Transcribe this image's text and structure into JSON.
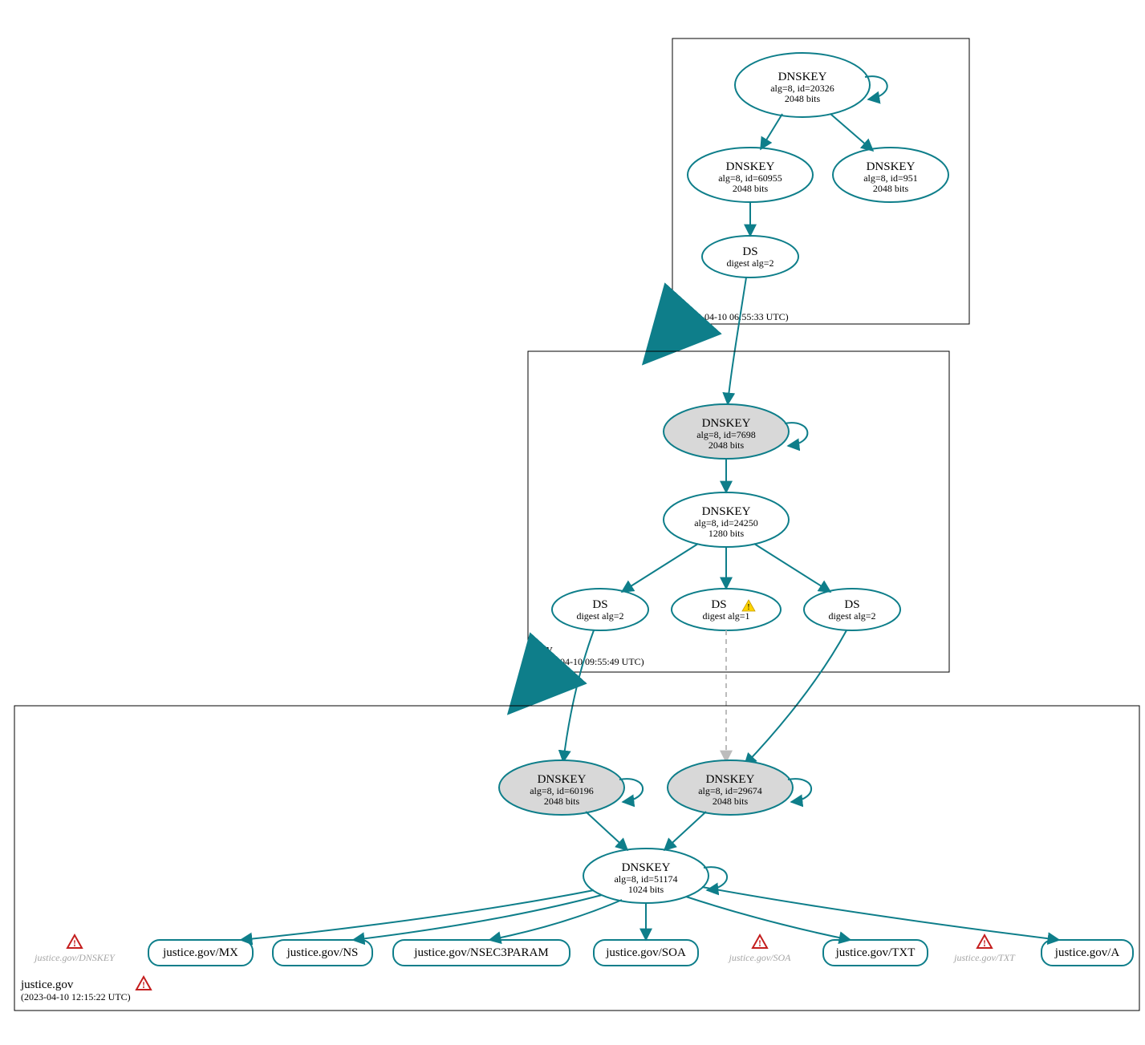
{
  "colors": {
    "stroke": "#0e7e8a",
    "fill_gray": "#d8d8d8"
  },
  "zones": {
    "root": {
      "label": ".",
      "timestamp": "(2023-04-10 06:55:33 UTC)",
      "nodes": {
        "ksk": {
          "title": "DNSKEY",
          "sub1": "alg=8, id=20326",
          "sub2": "2048 bits"
        },
        "zsk1": {
          "title": "DNSKEY",
          "sub1": "alg=8, id=60955",
          "sub2": "2048 bits"
        },
        "zsk2": {
          "title": "DNSKEY",
          "sub1": "alg=8, id=951",
          "sub2": "2048 bits"
        },
        "ds": {
          "title": "DS",
          "sub1": "digest alg=2"
        }
      }
    },
    "gov": {
      "label": "gov",
      "timestamp": "(2023-04-10 09:55:49 UTC)",
      "nodes": {
        "ksk": {
          "title": "DNSKEY",
          "sub1": "alg=8, id=7698",
          "sub2": "2048 bits"
        },
        "zsk": {
          "title": "DNSKEY",
          "sub1": "alg=8, id=24250",
          "sub2": "1280 bits"
        },
        "ds1": {
          "title": "DS",
          "sub1": "digest alg=2"
        },
        "ds2": {
          "title": "DS",
          "sub1": "digest alg=1"
        },
        "ds3": {
          "title": "DS",
          "sub1": "digest alg=2"
        }
      }
    },
    "justice": {
      "label": "justice.gov",
      "timestamp": "(2023-04-10 12:15:22 UTC)",
      "nodes": {
        "ksk1": {
          "title": "DNSKEY",
          "sub1": "alg=8, id=60196",
          "sub2": "2048 bits"
        },
        "ksk2": {
          "title": "DNSKEY",
          "sub1": "alg=8, id=29674",
          "sub2": "2048 bits"
        },
        "zsk": {
          "title": "DNSKEY",
          "sub1": "alg=8, id=51174",
          "sub2": "1024 bits"
        }
      },
      "rrsets": {
        "mx": "justice.gov/MX",
        "ns": "justice.gov/NS",
        "nsec3param": "justice.gov/NSEC3PARAM",
        "soa": "justice.gov/SOA",
        "txt": "justice.gov/TXT",
        "a": "justice.gov/A"
      },
      "warnings": {
        "dnskey": "justice.gov/DNSKEY",
        "soa": "justice.gov/SOA",
        "txt": "justice.gov/TXT"
      }
    }
  }
}
